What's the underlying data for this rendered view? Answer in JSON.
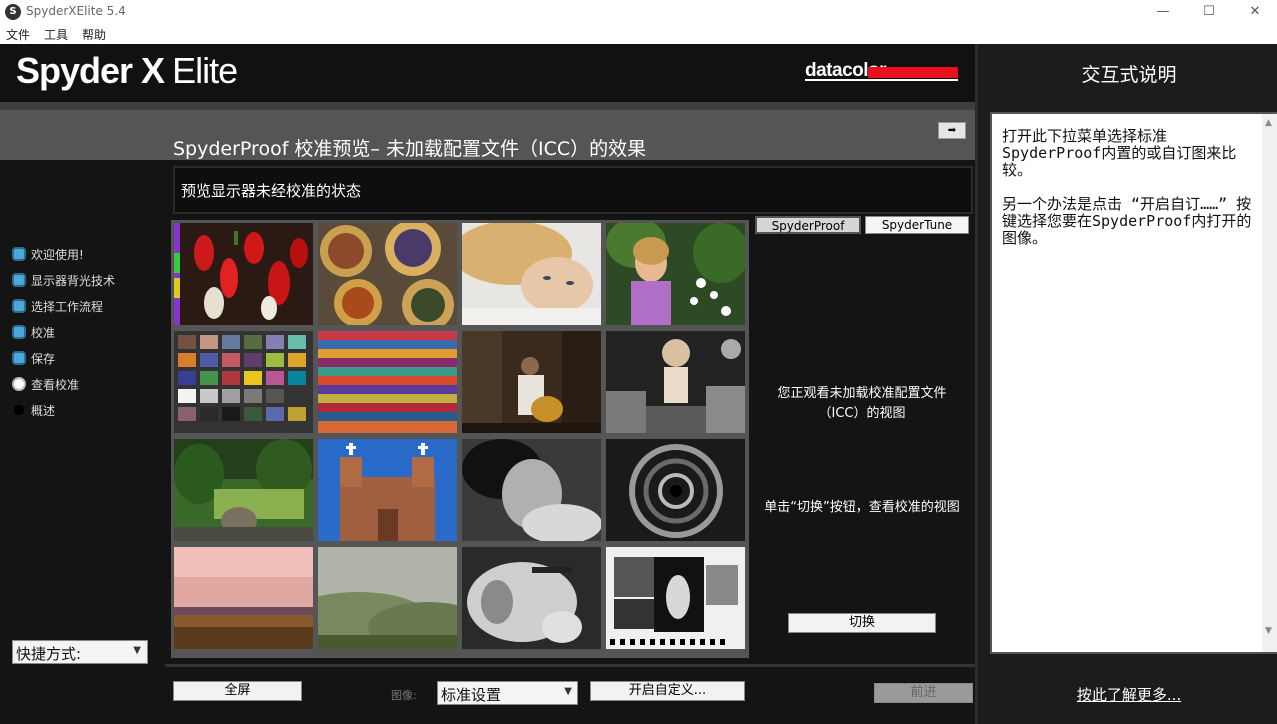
{
  "window": {
    "title": "SpyderXElite 5.4",
    "app_icon": "S",
    "minimize": "—",
    "maximize": "☐",
    "close": "✕"
  },
  "menu": [
    "文件",
    "工具",
    "帮助"
  ],
  "header": {
    "logo_bold": "Spyder X",
    "logo_light": "Elite",
    "brand": "datacolor"
  },
  "help": {
    "title": "交互式说明",
    "paragraph1": "打开此下拉菜单选择标准SpyderProof内置的或自订图来比较。",
    "paragraph2": "另一个办法是点击 “开启自订……” 按键选择您要在SpyderProof内打开的图像。",
    "learn_more": "按此了解更多..."
  },
  "page": {
    "title": "SpyderProof 校准预览– 未加载配置文件（ICC）的效果",
    "collapse": "➡",
    "subtitle": "预览显示器未经校准的状态"
  },
  "sidebar": {
    "items": [
      {
        "label": "欢迎使用!"
      },
      {
        "label": "显示器背光技术"
      },
      {
        "label": "选择工作流程"
      },
      {
        "label": "校准"
      },
      {
        "label": "保存"
      },
      {
        "label": "查看校准"
      },
      {
        "label": "概述"
      }
    ],
    "shortcut": "快捷方式:"
  },
  "tabs": {
    "proof": "SpyderProof",
    "tune": "SpyderTune"
  },
  "status": {
    "line1": "您正观看未加载校准配置文件（ICC）的视图",
    "line2": "单击“切换”按钮，查看校准的视图",
    "toggle": "切换"
  },
  "bottom": {
    "fullscreen": "全屏",
    "image_caption": "图像:",
    "image_select": "标准设置",
    "open_custom": "开启自定义...",
    "next": "前进"
  },
  "colors": {
    "accent_blue": "#4aa8d8",
    "brand_red": "#e8101e"
  }
}
